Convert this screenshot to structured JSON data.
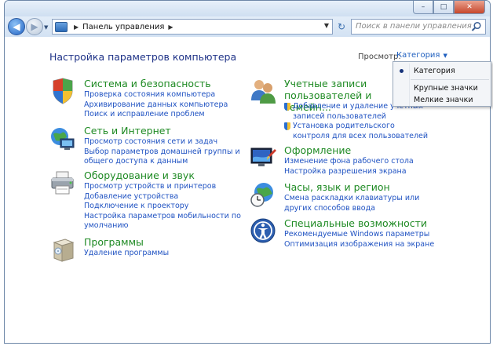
{
  "window": {
    "controls": {
      "minimize": "–",
      "maximize": "□",
      "close": "✕"
    }
  },
  "nav": {
    "breadcrumb": "Панель управления",
    "search_placeholder": "Поиск в панели управления"
  },
  "header": {
    "title": "Настройка параметров компьютера",
    "view_label": "Просмотр:",
    "view_value": "Категория"
  },
  "view_menu": {
    "items": [
      "Категория",
      "Крупные значки",
      "Мелкие значки"
    ],
    "selected": "Категория"
  },
  "categories_left": [
    {
      "title": "Система и безопасность",
      "icon": "shield-icon",
      "links": [
        "Проверка состояния компьютера",
        "Архивирование данных компьютера",
        "Поиск и исправление проблем"
      ]
    },
    {
      "title": "Сеть и Интернет",
      "icon": "network-globe-icon",
      "links": [
        "Просмотр состояния сети и задач",
        "Выбор параметров домашней группы и общего доступа к данным"
      ]
    },
    {
      "title": "Оборудование и звук",
      "icon": "printer-icon",
      "links": [
        "Просмотр устройств и принтеров",
        "Добавление устройства",
        "Подключение к проектору",
        "Настройка параметров мобильности по умолчанию"
      ]
    },
    {
      "title": "Программы",
      "icon": "programs-box-icon",
      "links": [
        "Удаление программы"
      ]
    }
  ],
  "categories_right": [
    {
      "title": "Учетные записи пользователей и семейн...",
      "icon": "users-icon",
      "links": [
        "Добавление и удаление учетных записей пользователей",
        "Установка родительского контроля для всех пользователей"
      ]
    },
    {
      "title": "Оформление",
      "icon": "appearance-monitor-icon",
      "links": [
        "Изменение фона рабочего стола",
        "Настройка разрешения экрана"
      ]
    },
    {
      "title": "Часы, язык и регион",
      "icon": "clock-globe-icon",
      "links": [
        "Смена раскладки клавиатуры или других способов ввода"
      ]
    },
    {
      "title": "Специальные возможности",
      "icon": "accessibility-icon",
      "links": [
        "Рекомендуемые Windows параметры",
        "Оптимизация изображения на экране"
      ]
    }
  ],
  "colors": {
    "category_title": "#1e8a23",
    "link": "#1f52c2",
    "page_title": "#1e3287"
  }
}
